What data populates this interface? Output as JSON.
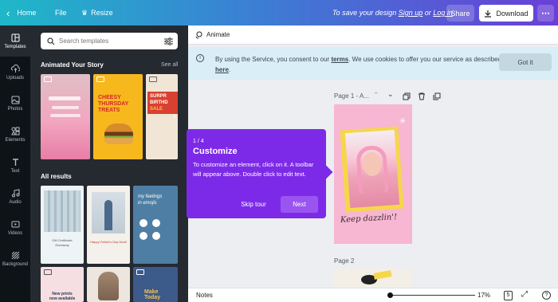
{
  "topbar": {
    "home": "Home",
    "file": "File",
    "resize": "Resize",
    "save_prompt_prefix": "To save your design",
    "signup": "Sign up",
    "or": "or",
    "login": "Log in",
    "share": "Share",
    "download": "Download",
    "more_icon": "ellipsis-icon"
  },
  "rail": {
    "items": [
      {
        "label": "Templates",
        "icon": "templates-icon",
        "active": true
      },
      {
        "label": "Uploads",
        "icon": "upload-icon"
      },
      {
        "label": "Photos",
        "icon": "photo-icon"
      },
      {
        "label": "Elements",
        "icon": "elements-icon"
      },
      {
        "label": "Text",
        "icon": "text-icon"
      },
      {
        "label": "Audio",
        "icon": "audio-icon"
      },
      {
        "label": "Videos",
        "icon": "video-icon"
      },
      {
        "label": "Background",
        "icon": "background-icon"
      }
    ]
  },
  "panel": {
    "search_placeholder": "Search templates",
    "animated_title": "Animated Your Story",
    "see_all": "See all",
    "all_results_title": "All results",
    "thumbs": {
      "cheesy": [
        "CHEESY",
        "THURSDAY",
        "TREATS"
      ],
      "birthday": [
        "SURPR",
        "BIRTHD",
        "SALE"
      ],
      "gift": [
        "Gift Certificate",
        "Giveaway"
      ],
      "fathers": "Happy Father's Day Deal!",
      "feelings": [
        "my feelings",
        "in emojis"
      ],
      "newprints": [
        "New prints",
        "now available"
      ],
      "make": [
        "Make",
        "Today"
      ]
    }
  },
  "editor": {
    "animate": "Animate",
    "cookie": {
      "text_before": "By using the Service, you consent to our",
      "terms": "terms",
      "text_middle": ". We use cookies to offer you our service as described",
      "here": "here",
      "text_after": ".",
      "got_it": "Got it"
    },
    "page1_label": "Page 1 - A...",
    "page2_label": "Page 2",
    "design_caption": "Keep dazzlin'!",
    "accent": "#f7b6d2"
  },
  "tour": {
    "step": "1 / 4",
    "title": "Customize",
    "body": "To customize an element, click on it. A toolbar will appear above. Double click to edit text.",
    "skip": "Skip tour",
    "next": "Next"
  },
  "footer": {
    "notes": "Notes",
    "zoom": "17%",
    "page_count": "5",
    "zoom_fraction": 0.1
  }
}
